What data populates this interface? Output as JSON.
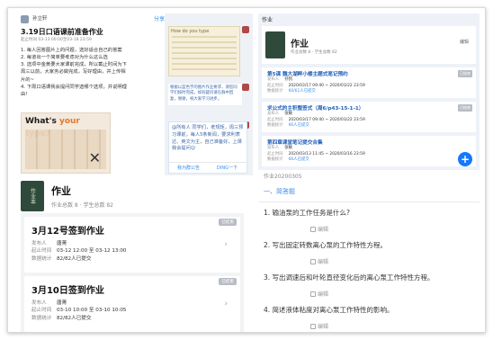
{
  "phone_a": {
    "author": "孙立轩",
    "share": "分享",
    "title": "3.19日口语课前准备作业",
    "subtitle": "起止时间 03-13 00:00至03-18 23:59",
    "items": [
      "1. 每人回答图片上的问题，选好适合自己的答案",
      "2. 每道出一个简单要考虑对为什么这么选",
      "3. 选项中金黄要大家课前完成，所以截止时间为下",
      "周三以前，大家务必做完成，写好理由，并上传相",
      "片的~",
      "4. 下周口语课我会提问同学选哪个选项，并说明理",
      "由!"
    ],
    "poster": {
      "pre": "What's ",
      "highlight": "your type?"
    }
  },
  "phone_b": {
    "image_caption": "How do you type",
    "chat_text": "根据以蓝色字的图片作业要求，请您同学们按时完成，如有疑问请在群中回复，谢谢，祝大家学习进步。",
    "card_text": "@所有人 同学们，老规矩，周三预习课前，每人5条新闻，要求利表达、英文为主，自己准备好，上课我会提问😊",
    "card_actions": [
      "我为群公告",
      "DING一下"
    ]
  },
  "book_a": {
    "cover": "作业本",
    "title": "作业",
    "stats": "作业总数 8 · 学生总数 82"
  },
  "sign_cards": [
    {
      "tag": "已结束",
      "title": "3月12号签到作业",
      "publisher_label": "发布人",
      "publisher": "唐菁",
      "period_label": "起止时间",
      "period": "03-12 12:00 至 03-12 13:00",
      "stats_label": "数据统计",
      "stats": "82/82人已提交"
    },
    {
      "tag": "已结束",
      "title": "3月10日签到作业",
      "publisher_label": "发布人",
      "publisher": "唐菁",
      "period_label": "起止时间",
      "period": "03-10 10:00 至 03-10 10:05",
      "stats_label": "数据统计",
      "stats": "82/82人已提交"
    }
  ],
  "phone_r": {
    "top_title": "作业",
    "head_title": "作业",
    "head_sub": "作业总数 8 · 学生总数 82",
    "edit": "编辑",
    "items": [
      {
        "title": "第5课 魏大湖畔小楼主题式笔记预约",
        "publisher": "孙凯",
        "period": "2020/03/17 09:40 ~ 2020/03/22 23:59",
        "stats": "60/61人已提交",
        "tag": "已结束"
      },
      {
        "title": "求公式的主积整签式（周6/p43-15-1-1）",
        "publisher": "张敏",
        "period": "2020/03/17 09:40 ~ 2020/03/22 23:59",
        "stats": "66人已提交",
        "tag": "已结束"
      },
      {
        "title": "第四章课堂笔记提交合集",
        "publisher": "张敏",
        "period": "2020/03/13 11:45 ~ 2020/03/16 23:59",
        "stats": "66人已提交",
        "tag": ""
      }
    ],
    "labels": {
      "publisher": "发布人",
      "period": "起止时间",
      "stats": "数据统计"
    }
  },
  "questions": {
    "date": "作业20200305",
    "section": "一、简答题",
    "edit_label": "编辑",
    "items": [
      "1. 输油泵的工作任务是什么?",
      "2. 写出固定转数离心泵的工作特性方程。",
      "3. 写出调速后和叶轮直径变化后的离心泵工作特性方程。",
      "4. 简述液体粘度对离心泵工作特性的影响。"
    ]
  },
  "colors": {
    "accent": "#3a8ee6",
    "fab": "#1677ff",
    "cover": "#2f4a3a"
  }
}
